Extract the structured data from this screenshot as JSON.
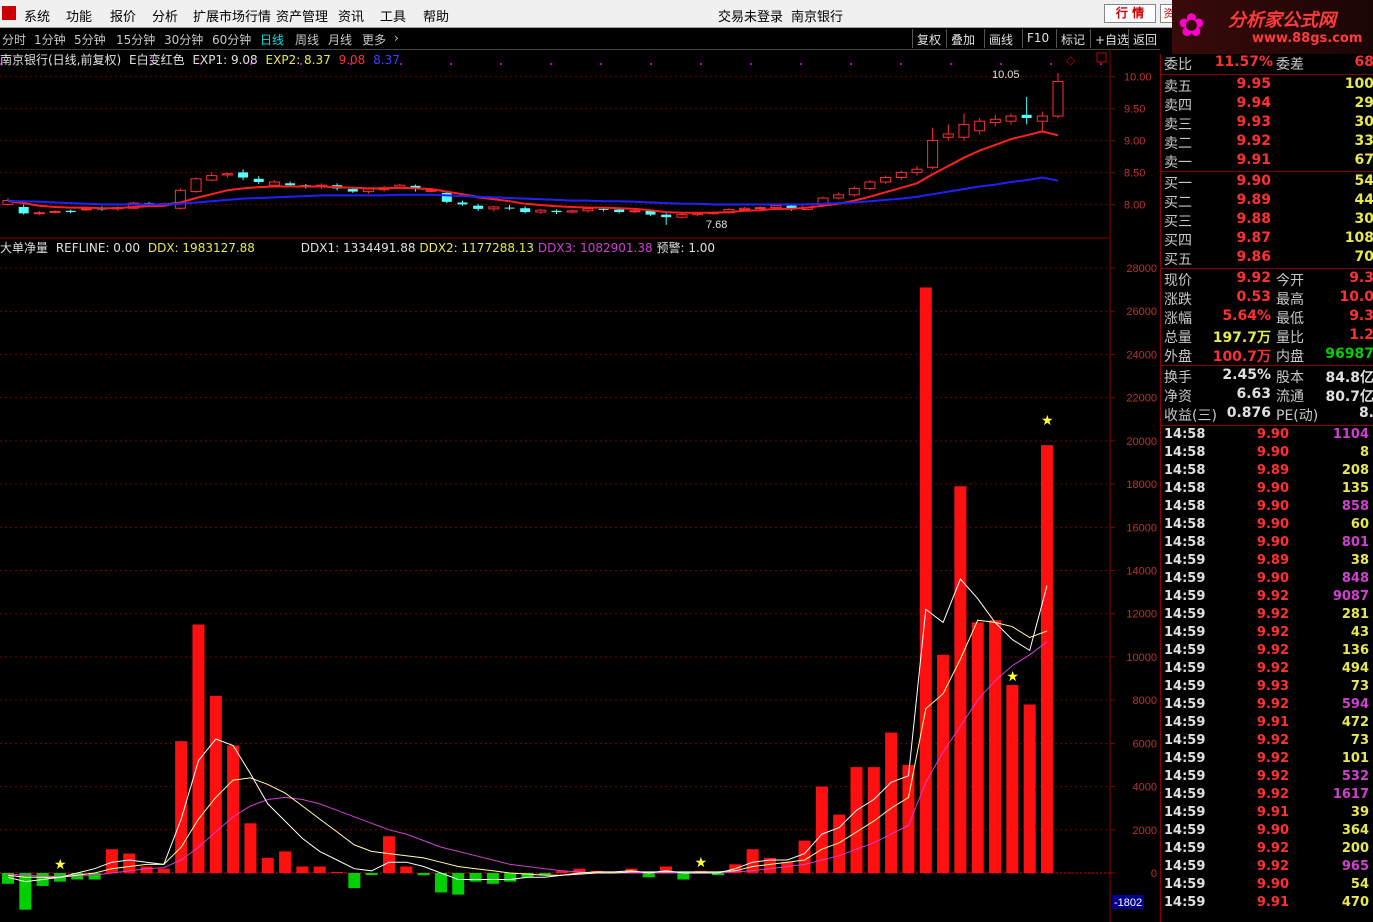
{
  "menubar": {
    "items": [
      "系统",
      "功能",
      "报价",
      "分析",
      "扩展市场行情",
      "资产管理",
      "资讯",
      "工具",
      "帮助"
    ],
    "login_status": "交易未登录",
    "stock_name": "南京银行",
    "hq_button": "行 情",
    "zi_button": "资"
  },
  "brand": {
    "title": "分析家公式网",
    "url": "www.88gs.com"
  },
  "toolbar": {
    "periods": [
      "分时",
      "1分钟",
      "5分钟",
      "15分钟",
      "30分钟",
      "60分钟",
      "日线",
      "周线",
      "月线",
      "更多"
    ],
    "active_period": "日线",
    "buttons": [
      "复权",
      "叠加",
      "画线",
      "F10",
      "标记",
      "+自选",
      "返回"
    ]
  },
  "main_chart": {
    "title": "南京银行(日线,前复权)",
    "indicator": "E白变红色",
    "exp1_label": "EXP1: 9.08",
    "exp2_label": "EXP2: 8.37",
    "exp1_value": "9.08",
    "exp2_value": "8.37",
    "high_annotation": "10.05",
    "low_annotation": "7.68"
  },
  "sub_chart": {
    "title": "大单净量",
    "refline": "REFLINE: 0.00",
    "ddx": "DDX: 1983127.88",
    "ddx1": "DDX1: 1334491.88",
    "ddx2": "DDX2: 1177288.13",
    "ddx3": "DDX3: 1082901.38",
    "alert": "预警: 1.00",
    "cursor_value": "-1802"
  },
  "colors": {
    "up": "#ff3030",
    "down": "#00c000",
    "exp1": "#ff2020",
    "exp2": "#2020ff",
    "ddx1": "#ffffff",
    "ddx2": "#ffffa0",
    "ddx3": "#d040d0"
  },
  "chart_data": [
    {
      "type": "candlestick",
      "title": "南京银行(日线,前复权)",
      "ylim": [
        7.6,
        10.1
      ],
      "yticks": [
        "10.00",
        "9.50",
        "9.00",
        "8.50",
        "8.00"
      ],
      "candles": [
        [
          8.0,
          8.06,
          7.98,
          8.1
        ],
        [
          7.96,
          7.86,
          7.84,
          8.0
        ],
        [
          7.86,
          7.87,
          7.83,
          7.9
        ],
        [
          7.88,
          7.89,
          7.86,
          7.91
        ],
        [
          7.9,
          7.88,
          7.86,
          7.92
        ],
        [
          7.92,
          7.93,
          7.9,
          7.95
        ],
        [
          7.95,
          7.92,
          7.9,
          7.97
        ],
        [
          7.93,
          7.95,
          7.9,
          7.97
        ],
        [
          7.94,
          8.02,
          7.93,
          8.04
        ],
        [
          8.02,
          8.0,
          7.97,
          8.04
        ],
        [
          8.0,
          8.01,
          7.98,
          8.03
        ],
        [
          7.94,
          8.22,
          7.92,
          8.25
        ],
        [
          8.2,
          8.4,
          8.18,
          8.42
        ],
        [
          8.38,
          8.45,
          8.36,
          8.5
        ],
        [
          8.46,
          8.48,
          8.42,
          8.5
        ],
        [
          8.5,
          8.42,
          8.38,
          8.55
        ],
        [
          8.4,
          8.35,
          8.32,
          8.44
        ],
        [
          8.3,
          8.35,
          8.28,
          8.38
        ],
        [
          8.33,
          8.3,
          8.28,
          8.36
        ],
        [
          8.3,
          8.28,
          8.25,
          8.32
        ],
        [
          8.28,
          8.3,
          8.24,
          8.33
        ],
        [
          8.3,
          8.25,
          8.22,
          8.33
        ],
        [
          8.24,
          8.2,
          8.18,
          8.27
        ],
        [
          8.2,
          8.24,
          8.17,
          8.27
        ],
        [
          8.23,
          8.26,
          8.2,
          8.29
        ],
        [
          8.27,
          8.3,
          8.25,
          8.32
        ],
        [
          8.29,
          8.24,
          8.2,
          8.31
        ],
        [
          8.22,
          8.22,
          8.19,
          8.25
        ],
        [
          8.18,
          8.04,
          8.02,
          8.21
        ],
        [
          8.03,
          8.0,
          7.98,
          8.06
        ],
        [
          7.98,
          7.93,
          7.9,
          8.01
        ],
        [
          7.93,
          7.96,
          7.89,
          7.98
        ],
        [
          7.95,
          7.94,
          7.91,
          7.99
        ],
        [
          7.94,
          7.88,
          7.86,
          7.97
        ],
        [
          7.88,
          7.91,
          7.85,
          7.93
        ],
        [
          7.9,
          7.88,
          7.85,
          7.92
        ],
        [
          7.88,
          7.9,
          7.86,
          7.92
        ],
        [
          7.9,
          7.93,
          7.87,
          7.95
        ],
        [
          7.93,
          7.92,
          7.89,
          7.96
        ],
        [
          7.92,
          7.88,
          7.86,
          7.94
        ],
        [
          7.89,
          7.9,
          7.86,
          7.92
        ],
        [
          7.9,
          7.84,
          7.82,
          7.92
        ],
        [
          7.84,
          7.8,
          7.68,
          7.86
        ],
        [
          7.8,
          7.84,
          7.78,
          7.86
        ],
        [
          7.84,
          7.86,
          7.82,
          7.88
        ],
        [
          7.86,
          7.87,
          7.84,
          7.89
        ],
        [
          7.87,
          7.92,
          7.86,
          7.94
        ],
        [
          7.92,
          7.94,
          7.9,
          7.96
        ],
        [
          7.94,
          7.95,
          7.92,
          7.97
        ],
        [
          7.95,
          7.98,
          7.93,
          8.0
        ],
        [
          7.98,
          7.92,
          7.9,
          8.0
        ],
        [
          7.92,
          8.0,
          7.91,
          8.02
        ],
        [
          8.0,
          8.1,
          7.99,
          8.12
        ],
        [
          8.1,
          8.15,
          8.08,
          8.18
        ],
        [
          8.15,
          8.25,
          8.12,
          8.28
        ],
        [
          8.25,
          8.35,
          8.22,
          8.38
        ],
        [
          8.35,
          8.42,
          8.32,
          8.45
        ],
        [
          8.42,
          8.5,
          8.38,
          8.53
        ],
        [
          8.5,
          8.55,
          8.45,
          8.6
        ],
        [
          8.58,
          9.0,
          8.55,
          9.2
        ],
        [
          9.05,
          9.1,
          9.0,
          9.25
        ],
        [
          9.05,
          9.25,
          9.0,
          9.42
        ],
        [
          9.15,
          9.3,
          9.1,
          9.35
        ],
        [
          9.28,
          9.33,
          9.22,
          9.4
        ],
        [
          9.3,
          9.38,
          9.25,
          9.42
        ],
        [
          9.4,
          9.35,
          9.25,
          9.68
        ],
        [
          9.3,
          9.38,
          9.12,
          9.45
        ],
        [
          9.38,
          9.92,
          9.35,
          10.05
        ]
      ],
      "exp1": [
        8.05,
        8.02,
        7.98,
        7.96,
        7.95,
        7.95,
        7.94,
        7.94,
        7.96,
        7.97,
        7.98,
        8.03,
        8.1,
        8.16,
        8.22,
        8.25,
        8.27,
        8.28,
        8.28,
        8.28,
        8.28,
        8.27,
        8.26,
        8.25,
        8.25,
        8.26,
        8.25,
        8.24,
        8.2,
        8.16,
        8.11,
        8.08,
        8.05,
        8.01,
        7.99,
        7.97,
        7.96,
        7.95,
        7.95,
        7.94,
        7.93,
        7.91,
        7.88,
        7.87,
        7.87,
        7.87,
        7.88,
        7.9,
        7.91,
        7.93,
        7.93,
        7.95,
        7.98,
        8.01,
        8.06,
        8.12,
        8.19,
        8.26,
        8.33,
        8.47,
        8.6,
        8.73,
        8.84,
        8.93,
        9.02,
        9.08,
        9.14,
        9.08
      ],
      "exp2": [
        8.05,
        8.05,
        8.04,
        8.03,
        8.02,
        8.01,
        8.0,
        8.0,
        8.0,
        8.0,
        8.0,
        8.01,
        8.03,
        8.05,
        8.07,
        8.09,
        8.1,
        8.11,
        8.12,
        8.13,
        8.14,
        8.14,
        8.14,
        8.14,
        8.14,
        8.15,
        8.15,
        8.15,
        8.14,
        8.13,
        8.12,
        8.11,
        8.1,
        8.09,
        8.08,
        8.07,
        8.06,
        8.06,
        8.05,
        8.05,
        8.04,
        8.03,
        8.02,
        8.01,
        8.01,
        8.0,
        8.0,
        8.0,
        8.0,
        8.0,
        8.0,
        8.0,
        8.01,
        8.02,
        8.03,
        8.05,
        8.07,
        8.09,
        8.12,
        8.16,
        8.2,
        8.24,
        8.28,
        8.31,
        8.35,
        8.38,
        8.42,
        8.37
      ]
    },
    {
      "type": "bar",
      "title": "大单净量",
      "ylim": [
        -1802,
        28000
      ],
      "yticks": [
        "28000",
        "26000",
        "24000",
        "22000",
        "20000",
        "18000",
        "16000",
        "14000",
        "12000",
        "10000",
        "8000",
        "6000",
        "4000",
        "2000",
        "0"
      ],
      "values": [
        -500,
        -1700,
        -600,
        -400,
        -300,
        -300,
        1100,
        900,
        300,
        200,
        6100,
        11500,
        8200,
        5900,
        2300,
        700,
        1000,
        300,
        300,
        50,
        -700,
        -100,
        1700,
        300,
        -100,
        -900,
        -1000,
        -400,
        -500,
        -400,
        -200,
        -100,
        100,
        200,
        100,
        50,
        200,
        -200,
        300,
        -300,
        100,
        -100,
        400,
        1100,
        700,
        500,
        1500,
        4000,
        2700,
        4900,
        4900,
        6500,
        5000,
        27100,
        10100,
        17900,
        11600,
        11700,
        8700,
        7800,
        19800
      ],
      "star_indices": [
        3,
        40,
        58
      ],
      "ddx1": [
        -200,
        -400,
        -300,
        -200,
        0,
        200,
        500,
        600,
        500,
        400,
        2500,
        5200,
        6200,
        5900,
        4600,
        3200,
        2400,
        1600,
        1000,
        600,
        200,
        100,
        500,
        500,
        300,
        0,
        -300,
        -300,
        -300,
        -300,
        -200,
        -200,
        -100,
        0,
        50,
        50,
        100,
        0,
        100,
        0,
        0,
        0,
        200,
        500,
        600,
        600,
        900,
        1800,
        2100,
        2900,
        3400,
        4200,
        4500,
        12200,
        11600,
        13600,
        12700,
        11600,
        10800,
        10300,
        13300
      ],
      "ddx2": [
        -100,
        -200,
        -200,
        -200,
        -100,
        0,
        200,
        300,
        400,
        400,
        1200,
        2500,
        3500,
        4300,
        4400,
        4100,
        3700,
        3100,
        2500,
        1900,
        1300,
        1000,
        900,
        800,
        700,
        500,
        300,
        200,
        100,
        0,
        -50,
        -100,
        -100,
        -50,
        0,
        0,
        50,
        50,
        50,
        50,
        50,
        50,
        100,
        300,
        400,
        500,
        600,
        1100,
        1400,
        1900,
        2400,
        3000,
        3500,
        7600,
        8300,
        9900,
        11700,
        11600,
        11400,
        10900,
        11200
      ],
      "ddx3": [
        -50,
        -100,
        -150,
        -150,
        -150,
        -100,
        0,
        100,
        200,
        250,
        600,
        1200,
        1900,
        2600,
        3100,
        3400,
        3500,
        3400,
        3200,
        2900,
        2600,
        2300,
        2000,
        1800,
        1500,
        1200,
        1000,
        800,
        600,
        400,
        300,
        200,
        100,
        50,
        0,
        0,
        0,
        0,
        0,
        0,
        0,
        0,
        50,
        100,
        200,
        300,
        400,
        600,
        800,
        1100,
        1400,
        1800,
        2200,
        4200,
        5600,
        6800,
        8000,
        8900,
        9600,
        10100,
        10700
      ]
    }
  ],
  "right_panel": {
    "weibi_label": "委比",
    "weibi_value": "11.57%",
    "weicha_label": "委差",
    "weicha_value": "68",
    "asks": [
      {
        "label": "卖五",
        "price": "9.95",
        "vol": "100"
      },
      {
        "label": "卖四",
        "price": "9.94",
        "vol": "29"
      },
      {
        "label": "卖三",
        "price": "9.93",
        "vol": "30"
      },
      {
        "label": "卖二",
        "price": "9.92",
        "vol": "33"
      },
      {
        "label": "卖一",
        "price": "9.91",
        "vol": "67"
      }
    ],
    "bids": [
      {
        "label": "买一",
        "price": "9.90",
        "vol": "54"
      },
      {
        "label": "买二",
        "price": "9.89",
        "vol": "44"
      },
      {
        "label": "买三",
        "price": "9.88",
        "vol": "30"
      },
      {
        "label": "买四",
        "price": "9.87",
        "vol": "108"
      },
      {
        "label": "买五",
        "price": "9.86",
        "vol": "70"
      }
    ],
    "stats": [
      {
        "l1": "现价",
        "v1": "9.92",
        "c1": "#ff3030",
        "l2": "今开",
        "v2": "9.3",
        "c2": "#ff3030"
      },
      {
        "l1": "涨跌",
        "v1": "0.53",
        "c1": "#ff3030",
        "l2": "最高",
        "v2": "10.0",
        "c2": "#ff3030"
      },
      {
        "l1": "涨幅",
        "v1": "5.64%",
        "c1": "#ff3030",
        "l2": "最低",
        "v2": "9.3",
        "c2": "#ff3030"
      },
      {
        "l1": "总量",
        "v1": "197.7万",
        "c1": "#e8e850",
        "l2": "量比",
        "v2": "1.2",
        "c2": "#ff3030"
      },
      {
        "l1": "外盘",
        "v1": "100.7万",
        "c1": "#ff3030",
        "l2": "内盘",
        "v2": "96987",
        "c2": "#00d000"
      }
    ],
    "stats2": [
      {
        "l1": "换手",
        "v1": "2.45%",
        "c1": "#e0e0e0",
        "l2": "股本",
        "v2": "84.8亿",
        "c2": "#e0e0e0"
      },
      {
        "l1": "净资",
        "v1": "6.63",
        "c1": "#e0e0e0",
        "l2": "流通",
        "v2": "80.7亿",
        "c2": "#e0e0e0"
      },
      {
        "l1": "收益(三)",
        "v1": "0.876",
        "c1": "#e0e0e0",
        "l2": "PE(动)",
        "v2": "8.",
        "c2": "#e0e0e0"
      }
    ],
    "ticks": [
      {
        "t": "14:58",
        "p": "9.90",
        "v": "1104",
        "c": "#d040d0"
      },
      {
        "t": "14:58",
        "p": "9.90",
        "v": "8",
        "c": "#e8e850"
      },
      {
        "t": "14:58",
        "p": "9.89",
        "v": "208",
        "c": "#e8e850"
      },
      {
        "t": "14:58",
        "p": "9.90",
        "v": "135",
        "c": "#e8e850"
      },
      {
        "t": "14:58",
        "p": "9.90",
        "v": "858",
        "c": "#d040d0"
      },
      {
        "t": "14:58",
        "p": "9.90",
        "v": "60",
        "c": "#e8e850"
      },
      {
        "t": "14:58",
        "p": "9.90",
        "v": "801",
        "c": "#d040d0"
      },
      {
        "t": "14:59",
        "p": "9.89",
        "v": "38",
        "c": "#e8e850"
      },
      {
        "t": "14:59",
        "p": "9.90",
        "v": "848",
        "c": "#d040d0"
      },
      {
        "t": "14:59",
        "p": "9.92",
        "v": "9087",
        "c": "#d040d0"
      },
      {
        "t": "14:59",
        "p": "9.92",
        "v": "281",
        "c": "#e8e850"
      },
      {
        "t": "14:59",
        "p": "9.92",
        "v": "43",
        "c": "#e8e850"
      },
      {
        "t": "14:59",
        "p": "9.92",
        "v": "136",
        "c": "#e8e850"
      },
      {
        "t": "14:59",
        "p": "9.92",
        "v": "494",
        "c": "#e8e850"
      },
      {
        "t": "14:59",
        "p": "9.93",
        "v": "73",
        "c": "#e8e850"
      },
      {
        "t": "14:59",
        "p": "9.92",
        "v": "594",
        "c": "#d040d0"
      },
      {
        "t": "14:59",
        "p": "9.91",
        "v": "472",
        "c": "#e8e850"
      },
      {
        "t": "14:59",
        "p": "9.92",
        "v": "73",
        "c": "#e8e850"
      },
      {
        "t": "14:59",
        "p": "9.92",
        "v": "101",
        "c": "#e8e850"
      },
      {
        "t": "14:59",
        "p": "9.92",
        "v": "532",
        "c": "#d040d0"
      },
      {
        "t": "14:59",
        "p": "9.92",
        "v": "1617",
        "c": "#d040d0"
      },
      {
        "t": "14:59",
        "p": "9.91",
        "v": "39",
        "c": "#e8e850"
      },
      {
        "t": "14:59",
        "p": "9.90",
        "v": "364",
        "c": "#e8e850"
      },
      {
        "t": "14:59",
        "p": "9.92",
        "v": "200",
        "c": "#e8e850"
      },
      {
        "t": "14:59",
        "p": "9.92",
        "v": "965",
        "c": "#d040d0"
      },
      {
        "t": "14:59",
        "p": "9.90",
        "v": "54",
        "c": "#e8e850"
      },
      {
        "t": "14:59",
        "p": "9.91",
        "v": "470",
        "c": "#e8e850"
      }
    ]
  }
}
